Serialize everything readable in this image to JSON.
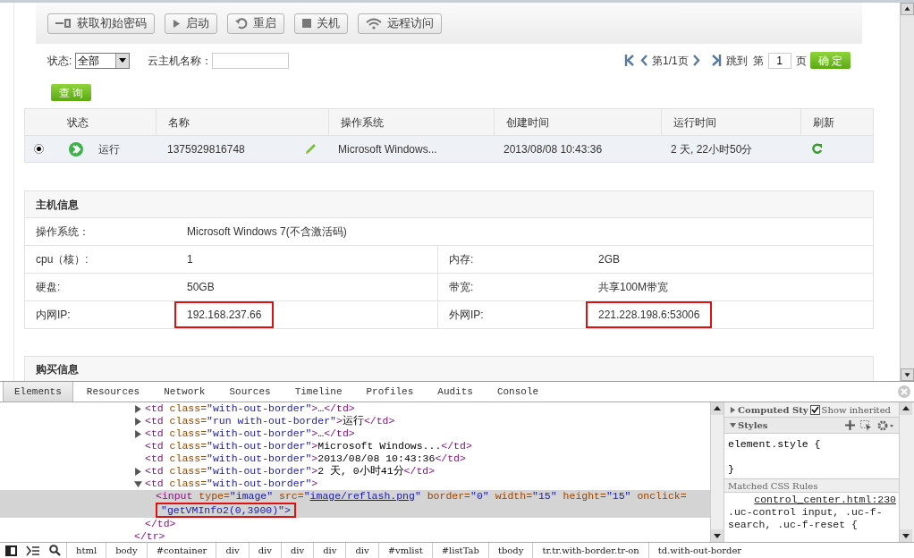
{
  "toolbar": {
    "buttons": [
      {
        "label": "获取初始密码"
      },
      {
        "label": "启动"
      },
      {
        "label": "重启"
      },
      {
        "label": "关机"
      },
      {
        "label": "远程访问"
      }
    ]
  },
  "filter": {
    "status_label": "状态:",
    "status_value": "全部",
    "name_label": "云主机名称：",
    "query_button": "查 询"
  },
  "pagination": {
    "page_text": "第1/1页",
    "jump_label": "跳到",
    "prefix": "第",
    "page_value": "1",
    "suffix": "页",
    "confirm_button": "确 定"
  },
  "vm_table": {
    "columns": [
      "状态",
      "名称",
      "操作系统",
      "创建时间",
      "运行时间",
      "刷新"
    ],
    "rows": [
      {
        "selected": true,
        "status": "运行",
        "name": "1375929816748",
        "os": "Microsoft Windows...",
        "created": "2013/08/08 10:43:36",
        "uptime": "2 天, 22小时50分"
      }
    ]
  },
  "host_info": {
    "title": "主机信息",
    "rows": [
      [
        {
          "label": "操作系统：",
          "value": "Microsoft Windows 7(不含激活码)",
          "highlighted": false
        }
      ],
      [
        {
          "label": "cpu（核）:",
          "value": "1",
          "highlighted": false
        },
        {
          "label": "内存:",
          "value": "2GB",
          "highlighted": false
        }
      ],
      [
        {
          "label": "硬盘:",
          "value": "50GB",
          "highlighted": false
        },
        {
          "label": "带宽:",
          "value": "共享100M带宽",
          "highlighted": false
        }
      ],
      [
        {
          "label": "内网IP:",
          "value": "192.168.237.66",
          "highlighted": true
        },
        {
          "label": "外网IP:",
          "value": "221.228.198.6:53006",
          "highlighted": true
        }
      ]
    ]
  },
  "purchase_info": {
    "title": "购买信息"
  },
  "devtools": {
    "tabs": [
      {
        "label": "Elements",
        "selected": true
      },
      {
        "label": "Resources",
        "selected": false
      },
      {
        "label": "Network",
        "selected": false
      },
      {
        "label": "Sources",
        "selected": false
      },
      {
        "label": "Timeline",
        "selected": false
      },
      {
        "label": "Profiles",
        "selected": false
      },
      {
        "label": "Audits",
        "selected": false
      },
      {
        "label": "Console",
        "selected": false
      }
    ],
    "dom_tree": {
      "children": [
        {
          "expanded": false,
          "selected": false,
          "tokens": [
            {
              "kind": "tag",
              "t": "<td"
            },
            {
              "kind": "attr",
              "t": " class="
            },
            {
              "kind": "value",
              "t": "\"with-out-border\""
            },
            {
              "kind": "tag",
              "t": ">"
            },
            {
              "kind": "text",
              "t": "…"
            },
            {
              "kind": "tag",
              "t": "</td>"
            }
          ]
        },
        {
          "expanded": false,
          "selected": false,
          "tokens": [
            {
              "kind": "tag",
              "t": "<td"
            },
            {
              "kind": "attr",
              "t": " class="
            },
            {
              "kind": "value",
              "t": "\"run with-out-border\""
            },
            {
              "kind": "tag",
              "t": ">"
            },
            {
              "kind": "text",
              "t": "运行"
            },
            {
              "kind": "tag",
              "t": "</td>"
            }
          ]
        },
        {
          "expanded": false,
          "selected": false,
          "tokens": [
            {
              "kind": "tag",
              "t": "<td"
            },
            {
              "kind": "attr",
              "t": " class="
            },
            {
              "kind": "value",
              "t": "\"with-out-border\""
            },
            {
              "kind": "tag",
              "t": ">"
            },
            {
              "kind": "text",
              "t": "…"
            },
            {
              "kind": "tag",
              "t": "</td>"
            }
          ]
        },
        {
          "selected": false,
          "tokens": [
            {
              "kind": "tag",
              "t": "<td"
            },
            {
              "kind": "attr",
              "t": " class="
            },
            {
              "kind": "value",
              "t": "\"with-out-border\""
            },
            {
              "kind": "tag",
              "t": ">"
            },
            {
              "kind": "text",
              "t": "Microsoft Windows..."
            },
            {
              "kind": "tag",
              "t": "</td>"
            }
          ]
        },
        {
          "selected": false,
          "tokens": [
            {
              "kind": "tag",
              "t": "<td"
            },
            {
              "kind": "attr",
              "t": " class="
            },
            {
              "kind": "value",
              "t": "\"with-out-border\""
            },
            {
              "kind": "tag",
              "t": ">"
            },
            {
              "kind": "text",
              "t": "2013/08/08 10:43:36"
            },
            {
              "kind": "tag",
              "t": "</td>"
            }
          ]
        },
        {
          "expanded": false,
          "selected": false,
          "tokens": [
            {
              "kind": "tag",
              "t": "<td"
            },
            {
              "kind": "attr",
              "t": " class="
            },
            {
              "kind": "value",
              "t": "\"with-out-border\""
            },
            {
              "kind": "tag",
              "t": ">"
            },
            {
              "kind": "text",
              "t": "2 天, 0小时41分"
            },
            {
              "kind": "tag",
              "t": "</td>"
            }
          ]
        },
        {
          "expanded": true,
          "selected": false,
          "tokens": [
            {
              "kind": "tag",
              "t": "<td"
            },
            {
              "kind": "attr",
              "t": " class="
            },
            {
              "kind": "value",
              "t": "\"with-out-border\""
            },
            {
              "kind": "tag",
              "t": ">"
            }
          ],
          "children": [
            {
              "selected": true,
              "tokens": [
                {
                  "kind": "tag",
                  "t": "<input"
                },
                {
                  "kind": "attr",
                  "t": " type="
                },
                {
                  "kind": "value",
                  "t": "\"image\""
                },
                {
                  "kind": "attr",
                  "t": " src="
                },
                {
                  "kind": "value",
                  "t": "\""
                },
                {
                  "kind": "link",
                  "t": "image/reflash.png"
                },
                {
                  "kind": "value",
                  "t": "\""
                },
                {
                  "kind": "attr",
                  "t": " border="
                },
                {
                  "kind": "value",
                  "t": "\"0\""
                },
                {
                  "kind": "attr",
                  "t": " width="
                },
                {
                  "kind": "value",
                  "t": "\"15\""
                },
                {
                  "kind": "attr",
                  "t": " height="
                },
                {
                  "kind": "value",
                  "t": "\"15\""
                },
                {
                  "kind": "attr",
                  "t": " onclick="
                },
                {
                  "kind": "boxed",
                  "t": "\"getVMInfo2(0,3900)\">"
                }
              ]
            }
          ],
          "closing": [
            {
              "kind": "tag",
              "t": "</td>"
            }
          ]
        }
      ],
      "closing": [
        {
          "kind": "tag",
          "t": "</tr>"
        }
      ]
    },
    "styles": {
      "computed_title": "Computed Sty",
      "show_inherited": {
        "label": "Show inherited",
        "checked": true
      },
      "styles_title": "Styles",
      "element_style_open": "element.style {",
      "element_style_close": "}",
      "matched_title": "Matched CSS Rules",
      "rule_source": "control_center.html:230",
      "rule_selector": ".uc-control input, .uc-f-search, .uc-f-reset {"
    },
    "breadcrumbs": [
      "html",
      "body",
      "#container",
      "div",
      "div",
      "div",
      "div",
      "div",
      "#vmlist",
      "#listTab",
      "tbody",
      "tr.tr.with-border.tr-on",
      "td.with-out-border"
    ]
  }
}
